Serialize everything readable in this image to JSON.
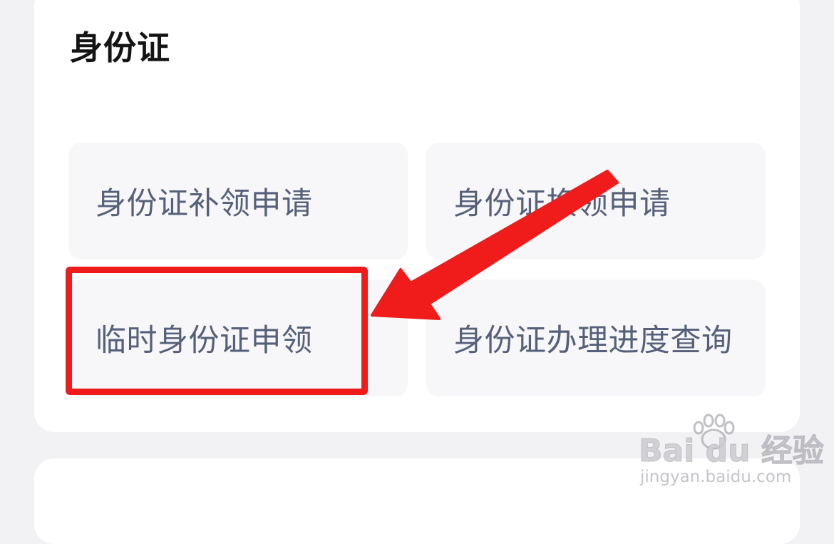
{
  "section": {
    "title": "身份证",
    "tiles": [
      {
        "label": "身份证补领申请"
      },
      {
        "label": "身份证换领申请"
      },
      {
        "label": "临时身份证申领"
      },
      {
        "label": "身份证办理进度查询"
      }
    ]
  },
  "annotation": {
    "highlight_color": "#f01c1c"
  },
  "watermark": {
    "brand": "Bai du 经验",
    "url": "jingyan.baidu.com"
  },
  "colors": {
    "background": "#f2f2f4",
    "card": "#ffffff",
    "tile": "#f7f7f9",
    "tile_text": "#56607a",
    "title_text": "#141414"
  }
}
